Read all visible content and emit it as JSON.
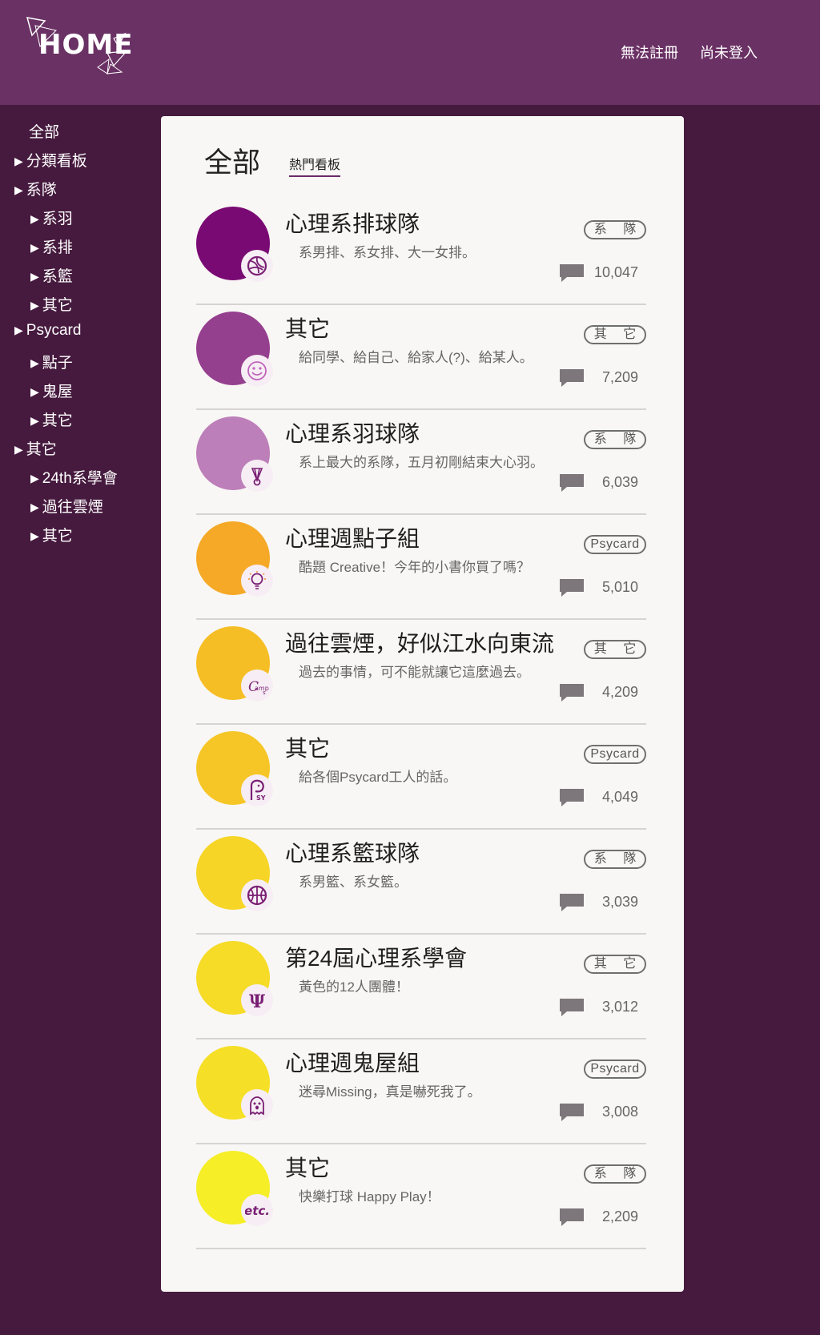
{
  "header": {
    "logo_text": "HOME",
    "nav": {
      "register": "無法註冊",
      "login": "尚未登入"
    }
  },
  "sidebar": {
    "items": [
      {
        "label": "全部",
        "level": 0,
        "arrow": false
      },
      {
        "label": "分類看板",
        "level": 0,
        "arrow": true
      },
      {
        "label": "系隊",
        "level": 0,
        "arrow": true
      },
      {
        "label": "系羽",
        "level": 1,
        "arrow": true
      },
      {
        "label": "系排",
        "level": 1,
        "arrow": true
      },
      {
        "label": "系籃",
        "level": 1,
        "arrow": true
      },
      {
        "label": "其它",
        "level": 1,
        "arrow": true
      },
      {
        "label": "Psycard",
        "level": 0,
        "arrow": true
      },
      {
        "label": "點子",
        "level": 1,
        "arrow": true
      },
      {
        "label": "鬼屋",
        "level": 1,
        "arrow": true
      },
      {
        "label": "其它",
        "level": 1,
        "arrow": true
      },
      {
        "label": "其它",
        "level": 0,
        "arrow": true
      },
      {
        "label": "24th系學會",
        "level": 1,
        "arrow": true
      },
      {
        "label": "過往雲煙",
        "level": 1,
        "arrow": true
      },
      {
        "label": "其它",
        "level": 1,
        "arrow": true
      }
    ]
  },
  "main": {
    "title": "全部",
    "tab": "熱門看板",
    "boards": [
      {
        "name": "心理系排球隊",
        "desc": "系男排、系女排、大一女排。",
        "tag": "系 隊",
        "count": "10,047",
        "color": "#7a0a73",
        "icon": "volleyball-icon"
      },
      {
        "name": "其它",
        "desc": "給同學、給自己、給家人(?)、給某人。",
        "tag": "其 它",
        "count": "7,209",
        "color": "#953f8f",
        "icon": "smiley-icon"
      },
      {
        "name": "心理系羽球隊",
        "desc": "系上最大的系隊，五月初剛結束大心羽。",
        "tag": "系 隊",
        "count": "6,039",
        "color": "#bd7fb9",
        "icon": "shuttlecock-icon"
      },
      {
        "name": "心理週點子組",
        "desc": "酷題 Creative！今年的小書你買了嗎？",
        "tag": "Psycard",
        "count": "5,010",
        "color": "#f5a927",
        "icon": "lightbulb-icon"
      },
      {
        "name": "過往雲煙，好似江水向東流",
        "desc": "過去的事情，可不能就讓它這麼過去。",
        "tag": "其 它",
        "count": "4,209",
        "color": "#f6be25",
        "icon": "camps-icon"
      },
      {
        "name": "其它",
        "desc": "給各個Psycard工人的話。",
        "tag": "Psycard",
        "count": "4,049",
        "color": "#f6c627",
        "icon": "psy-icon"
      },
      {
        "name": "心理系籃球隊",
        "desc": "系男籃、系女籃。",
        "tag": "系 隊",
        "count": "3,039",
        "color": "#f6d527",
        "icon": "basketball-icon"
      },
      {
        "name": "第24屆心理系學會",
        "desc": "黃色的12人團體！",
        "tag": "其 它",
        "count": "3,012",
        "color": "#f6db27",
        "icon": "psi-icon"
      },
      {
        "name": "心理週鬼屋組",
        "desc": "迷尋Missing，真是嚇死我了。",
        "tag": "Psycard",
        "count": "3,008",
        "color": "#f6df27",
        "icon": "ghost-icon"
      },
      {
        "name": "其它",
        "desc": "快樂打球 Happy Play！",
        "tag": "系 隊",
        "count": "2,209",
        "color": "#f6ee27",
        "icon": "etc-icon"
      }
    ]
  }
}
